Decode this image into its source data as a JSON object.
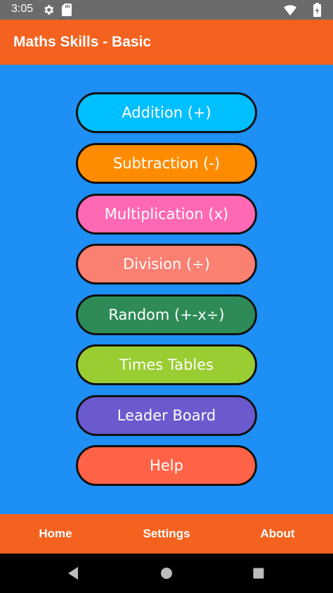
{
  "status_bar": {
    "time": "3:05",
    "icons": [
      "gear-icon",
      "sd-card-icon",
      "wifi-icon",
      "battery-icon"
    ]
  },
  "app_bar": {
    "title": "Maths Skills - Basic",
    "color": "#f4621f"
  },
  "background_color": "#1e8ff5",
  "menu": {
    "items": [
      {
        "label": "Addition (+)",
        "color": "#00bfff"
      },
      {
        "label": "Subtraction (-)",
        "color": "#ff8c00"
      },
      {
        "label": "Multiplication (x)",
        "color": "#ff69b4"
      },
      {
        "label": "Division (÷)",
        "color": "#fa8072"
      },
      {
        "label": "Random (+-x÷)",
        "color": "#2e8b57"
      },
      {
        "label": "Times Tables",
        "color": "#9acd32"
      },
      {
        "label": "Leader Board",
        "color": "#6a5acd"
      },
      {
        "label": "Help",
        "color": "#ff6347"
      }
    ]
  },
  "bottom_nav": {
    "home": "Home",
    "settings": "Settings",
    "about": "About"
  },
  "system_nav": {
    "icons": [
      "back-icon",
      "home-circle-icon",
      "recents-icon"
    ]
  }
}
